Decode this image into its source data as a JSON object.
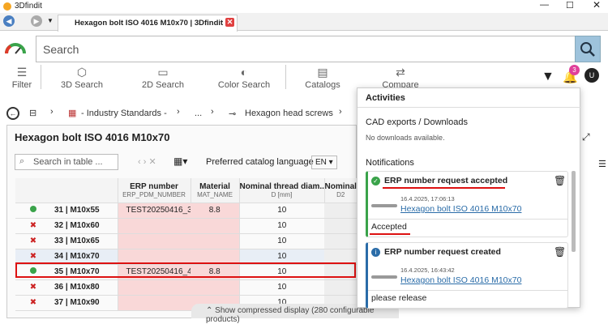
{
  "window": {
    "title": "3Dfindit"
  },
  "tab": {
    "title": "Hexagon bolt ISO 4016 M10x70 | 3Dfindit",
    "close_icon": "close-icon"
  },
  "search": {
    "placeholder": "Search"
  },
  "toolbar": {
    "filter": "Filter",
    "items": [
      "3D Search",
      "2D Search",
      "Color Search",
      "Catalogs",
      "Compare"
    ],
    "badge": "3"
  },
  "breadcrumb": {
    "items": [
      "- Industry Standards -",
      "...",
      "Hexagon head screws"
    ]
  },
  "panel": {
    "title": "Hexagon bolt ISO 4016 M10x70",
    "table_search_placeholder": "Search in table ...",
    "preferred_label": "Preferred catalog language",
    "lang": "EN",
    "compress": "Show compressed display (280 configurable products)"
  },
  "table": {
    "headers": [
      {
        "title": "ERP number",
        "sub": "ERP_PDM_NUMBER"
      },
      {
        "title": "Material",
        "sub": "MAT_NAME"
      },
      {
        "title": "Nominal thread diam...",
        "sub": "D [mm]"
      },
      {
        "title": "Nominal",
        "sub": "D2"
      }
    ],
    "rows": [
      {
        "id": "31 | M10x55",
        "erp": "TEST20250416_3",
        "mat": "8.8",
        "d": "10",
        "status": "green"
      },
      {
        "id": "32 | M10x60",
        "erp": "",
        "mat": "",
        "d": "10",
        "status": "red"
      },
      {
        "id": "33 | M10x65",
        "erp": "",
        "mat": "",
        "d": "10",
        "status": "red"
      },
      {
        "id": "34 | M10x70",
        "erp": "",
        "mat": "",
        "d": "10",
        "status": "red"
      },
      {
        "id": "35 | M10x70",
        "erp": "TEST20250416_4",
        "mat": "8.8",
        "d": "10",
        "status": "green"
      },
      {
        "id": "36 | M10x80",
        "erp": "",
        "mat": "",
        "d": "10",
        "status": "red"
      },
      {
        "id": "37 | M10x90",
        "erp": "",
        "mat": "",
        "d": "10",
        "status": "red"
      }
    ]
  },
  "activities": {
    "title": "Activities",
    "cad_title": "CAD exports / Downloads",
    "cad_empty": "No downloads available.",
    "notif_title": "Notifications",
    "n1": {
      "title": "ERP number request accepted",
      "date": "16.4.2025, 17:06:13",
      "link": "Hexagon bolt ISO 4016 M10x70",
      "status": "Accepted"
    },
    "n2": {
      "title": "ERP number request created",
      "date": "16.4.2025, 16:43:42",
      "link": "Hexagon bolt ISO 4016 M10x70",
      "note": "please release"
    }
  },
  "colors": {
    "accent": "#2a6ca8",
    "pink": "#f9d8d8",
    "alert": "#d11111",
    "badge": "#e0409a"
  }
}
